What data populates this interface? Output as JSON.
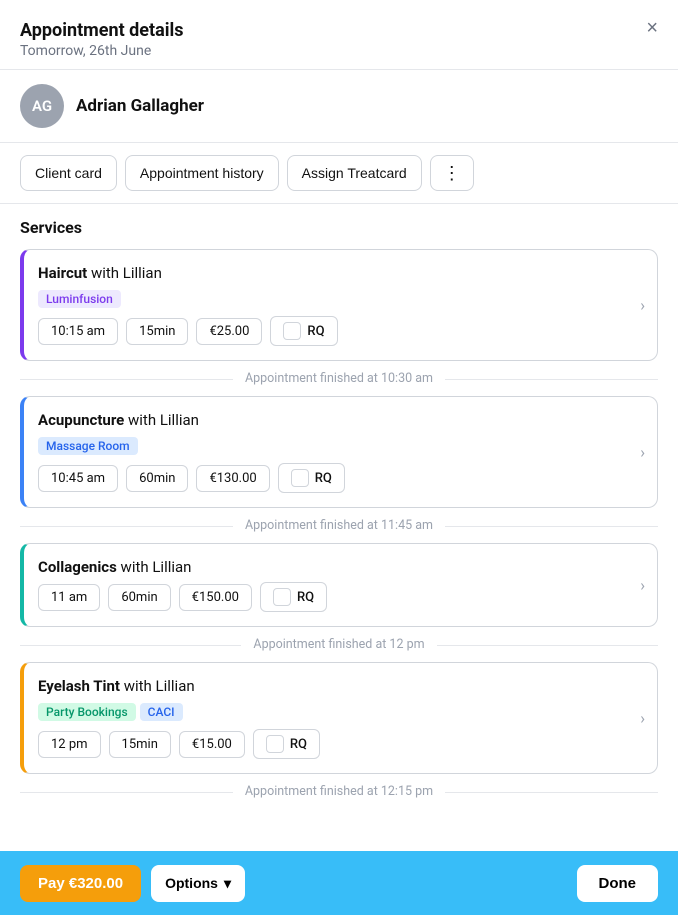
{
  "header": {
    "title": "Appointment details",
    "date": "Tomorrow, 26th June",
    "close_label": "×"
  },
  "client": {
    "initials": "AG",
    "name": "Adrian Gallagher"
  },
  "actions": {
    "client_card": "Client card",
    "appointment_history": "Appointment history",
    "assign_treatcard": "Assign Treatcard",
    "more": "⋮"
  },
  "services_label": "Services",
  "services": [
    {
      "title_bold": "Haircut",
      "title_rest": " with Lillian",
      "border_class": "purple-border",
      "tags": [
        {
          "label": "Luminfusion",
          "color": "purple"
        }
      ],
      "time": "10:15 am",
      "duration": "15min",
      "price": "€25.00",
      "rq": "RQ",
      "finished_at": "Appointment finished at 10:30 am"
    },
    {
      "title_bold": "Acupuncture",
      "title_rest": " with Lillian",
      "border_class": "blue-border",
      "tags": [
        {
          "label": "Massage Room",
          "color": "blue"
        }
      ],
      "time": "10:45 am",
      "duration": "60min",
      "price": "€130.00",
      "rq": "RQ",
      "finished_at": "Appointment finished at 11:45 am"
    },
    {
      "title_bold": "Collagenics",
      "title_rest": " with Lillian",
      "border_class": "teal-border",
      "tags": [],
      "time": "11 am",
      "duration": "60min",
      "price": "€150.00",
      "rq": "RQ",
      "finished_at": "Appointment finished at 12 pm"
    },
    {
      "title_bold": "Eyelash Tint",
      "title_rest": " with Lillian",
      "border_class": "orange-border",
      "tags": [
        {
          "label": "Party Bookings",
          "color": "green"
        },
        {
          "label": "CACI",
          "color": "blue"
        }
      ],
      "time": "12 pm",
      "duration": "15min",
      "price": "€15.00",
      "rq": "RQ",
      "finished_at": "Appointment finished at 12:15 pm"
    }
  ],
  "bottom_bar": {
    "pay_label": "Pay €320.00",
    "options_label": "Options",
    "done_label": "Done"
  }
}
